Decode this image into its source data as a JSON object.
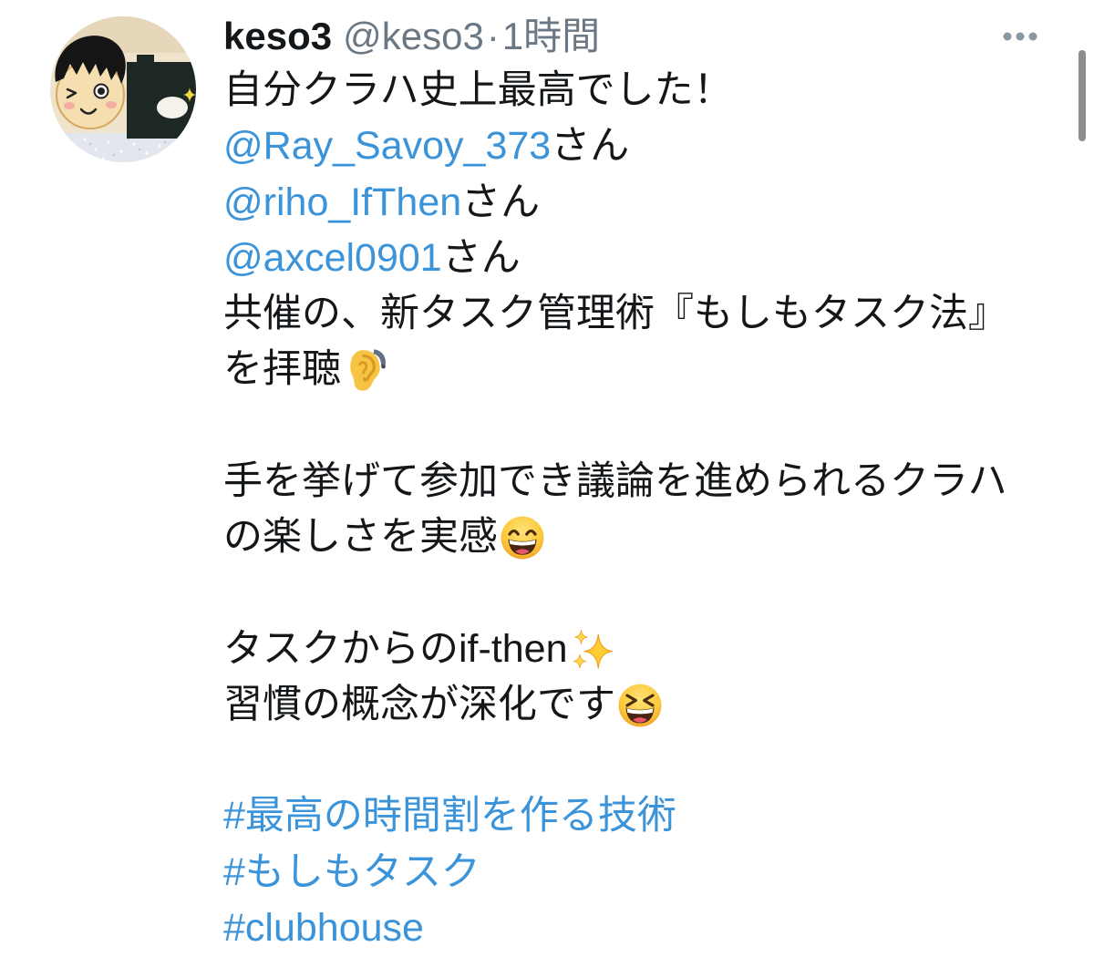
{
  "tweet": {
    "author": {
      "display_name": "keso3",
      "handle": "@keso3",
      "separator": "·",
      "timestamp": "1時間",
      "avatar_icon": "cartoon-drawing-avatar"
    },
    "more_icon": "more-horizontal-icon",
    "body": {
      "intro": "自分クラハ史上最高でした！",
      "mentions": [
        {
          "handle": "@Ray_Savoy_373",
          "suffix": "さん"
        },
        {
          "handle": "@riho_IfThen",
          "suffix": "さん"
        },
        {
          "handle": "@axcel0901",
          "suffix": "さん"
        }
      ],
      "paragraphs": [
        {
          "lines": [
            {
              "text": "共催の、新タスク管理術『もしもタスク法』"
            },
            {
              "text": "を拝聴",
              "emoji": "ear-with-hearing-aid-emoji"
            }
          ]
        },
        {
          "lines": [
            {
              "text": "手を挙げて参加でき議論を進められるクラハ"
            },
            {
              "text": "の楽しさを実感",
              "emoji": "grinning-face-with-smiling-eyes-emoji"
            }
          ]
        },
        {
          "lines": [
            {
              "text": "タスクからのif-then",
              "emoji": "sparkles-emoji"
            },
            {
              "text": "習慣の概念が深化です",
              "emoji": "grinning-squinting-face-emoji"
            }
          ]
        }
      ],
      "hashtags": [
        "#最高の時間割を作る技術",
        "#もしもタスク",
        "#clubhouse"
      ]
    }
  },
  "colors": {
    "text": "#14171a",
    "link": "#3b94d9",
    "secondary": "#6b7884",
    "background": "#ffffff"
  }
}
